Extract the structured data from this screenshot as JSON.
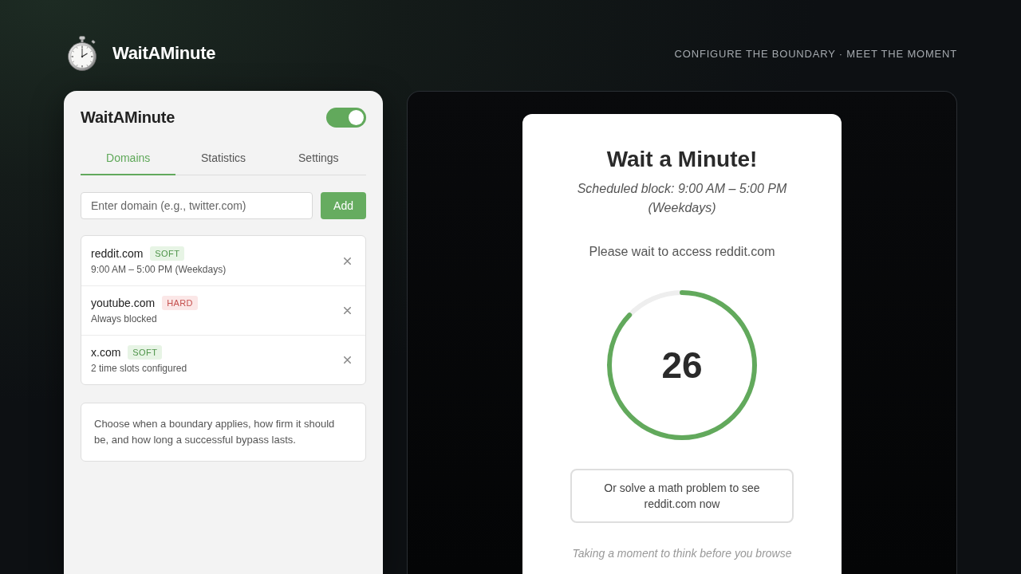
{
  "header": {
    "app_name": "WaitAMinute",
    "tagline": "CONFIGURE THE BOUNDARY · MEET THE MOMENT"
  },
  "popup": {
    "title": "WaitAMinute",
    "enabled": true,
    "tabs": [
      {
        "label": "Domains",
        "selected": true
      },
      {
        "label": "Statistics",
        "selected": false
      },
      {
        "label": "Settings",
        "selected": false
      }
    ],
    "domain_input": {
      "placeholder": "Enter domain (e.g., twitter.com)"
    },
    "add_button": "Add",
    "domains": [
      {
        "name": "reddit.com",
        "kind": "soft",
        "mode": "SOFT",
        "detail": "9:00 AM – 5:00 PM (Weekdays)"
      },
      {
        "name": "youtube.com",
        "kind": "hard",
        "mode": "HARD",
        "detail": "Always blocked"
      },
      {
        "name": "x.com",
        "kind": "soft",
        "mode": "SOFT",
        "detail": "2 time slots configured"
      }
    ],
    "info": "Choose when a boundary applies, how firm it should be, and how long a successful bypass lasts."
  },
  "block_page": {
    "title": "Wait a Minute!",
    "schedule": "Scheduled block: 9:00 AM – 5:00 PM (Weekdays)",
    "message": "Please wait to access reddit.com",
    "countdown": {
      "value": "26",
      "level": 0.87
    },
    "math_button": "Or solve a math problem to see reddit.com now",
    "footer": "Taking a moment to think before you browse"
  }
}
